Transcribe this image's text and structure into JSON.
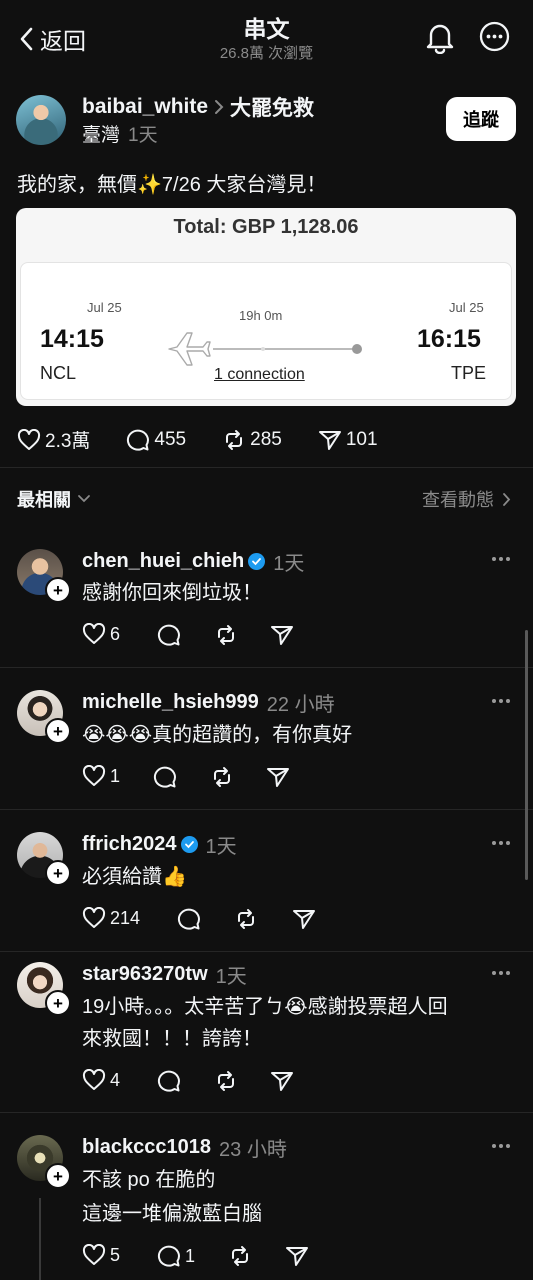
{
  "header": {
    "title": "串文",
    "views": "26.8萬 次瀏覽",
    "back_label": "返回"
  },
  "post": {
    "username": "baibai_white",
    "tag": "大罷免救",
    "location": "臺灣",
    "time": "1天",
    "follow_label": "追蹤",
    "text": "我的家，無價✨7/26 大家台灣見！",
    "card": {
      "total": "Total: GBP 1,128.06",
      "dep_date": "Jul 25",
      "dep_time": "14:15",
      "dep_code": "NCL",
      "duration": "19h 0m",
      "connection": "1 connection",
      "arr_date": "Jul 25",
      "arr_time": "16:15",
      "arr_code": "TPE"
    },
    "stats": {
      "likes": "2.3萬",
      "replies": "455",
      "reposts": "285",
      "shares": "101"
    }
  },
  "sort": {
    "label": "最相關",
    "activity": "查看動態"
  },
  "comments": [
    {
      "username": "chen_huei_chieh",
      "verified": true,
      "time": "1天",
      "lines": [
        "感謝你回來倒垃圾！"
      ],
      "likes": "6",
      "replies": ""
    },
    {
      "username": "michelle_hsieh999",
      "verified": false,
      "time": "22 小時",
      "lines": [
        "😭😭😭真的超讚的，有你真好"
      ],
      "likes": "1",
      "replies": ""
    },
    {
      "username": "ffrich2024",
      "verified": true,
      "time": "1天",
      "lines": [
        "必須給讚👍"
      ],
      "likes": "214",
      "replies": ""
    },
    {
      "username": "star963270tw",
      "verified": false,
      "time": "1天",
      "lines": [
        "19小時。。。太辛苦了ㄅ😭感謝投票超人回",
        "來救國！！！誇誇！"
      ],
      "likes": "4",
      "replies": ""
    },
    {
      "username": "blackccc1018",
      "verified": false,
      "time": "23 小時",
      "lines": [
        "不該 po 在脆的",
        "這邊一堆偏激藍白腦"
      ],
      "likes": "5",
      "replies": "1"
    }
  ],
  "icons": {
    "back": "chevron-left-icon",
    "notifications": "bell-icon",
    "more": "ellipsis-circle-icon",
    "like": "heart-icon",
    "reply": "comment-icon",
    "repost": "repost-icon",
    "share": "send-icon",
    "verified": "verified-badge-icon"
  },
  "colors": {
    "background": "#101010",
    "text": "#f3f5f7",
    "muted": "#8a8a8a",
    "verified": "#1d9bf0"
  }
}
